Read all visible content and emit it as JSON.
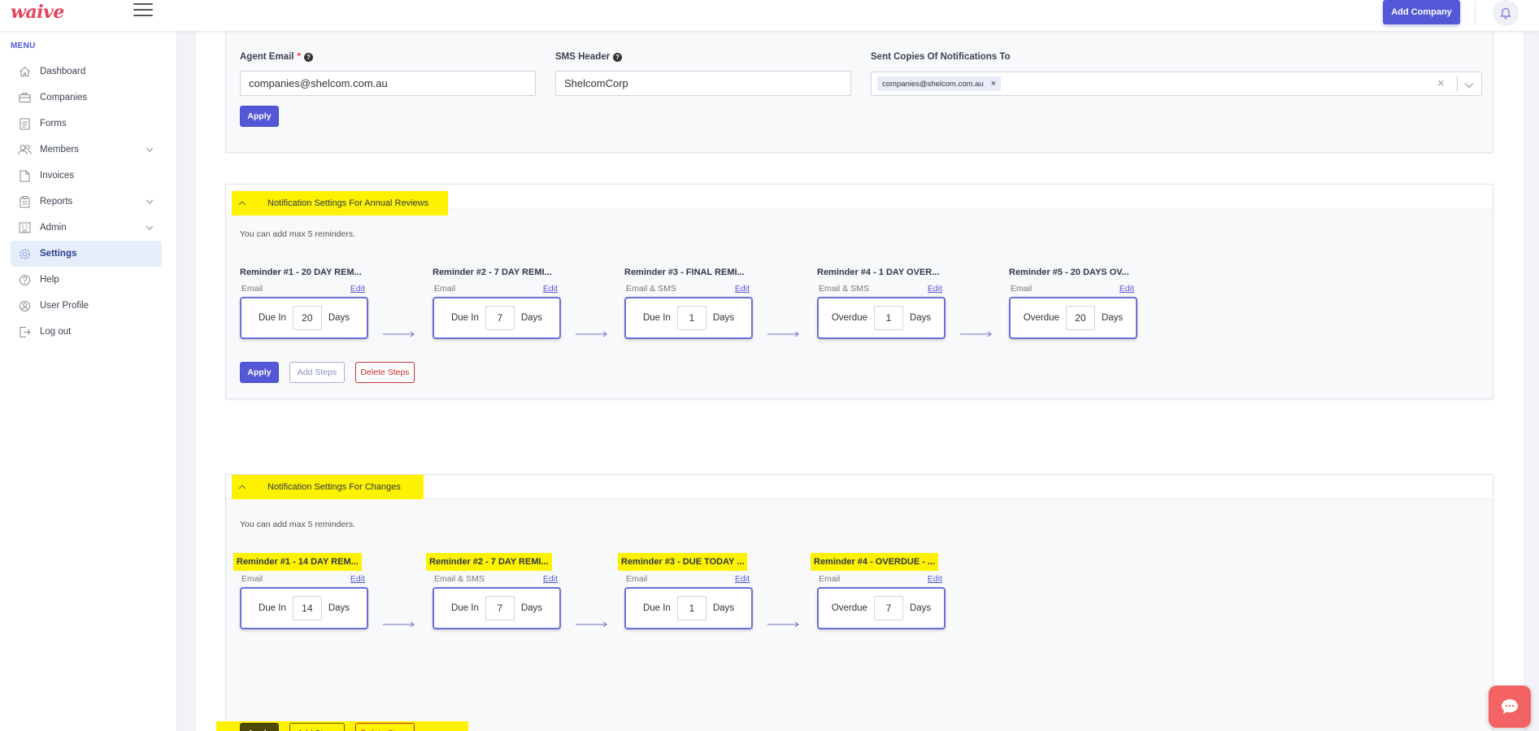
{
  "app": {
    "logo": "waive"
  },
  "topbar": {
    "add_company_label": "Add Company"
  },
  "sidebar": {
    "menu_label": "MENU",
    "items": [
      {
        "label": "Dashboard",
        "icon": "home-icon"
      },
      {
        "label": "Companies",
        "icon": "briefcase-icon"
      },
      {
        "label": "Forms",
        "icon": "document-icon"
      },
      {
        "label": "Members",
        "icon": "users-icon",
        "has_children": true
      },
      {
        "label": "Invoices",
        "icon": "file-icon"
      },
      {
        "label": "Reports",
        "icon": "clipboard-icon",
        "has_children": true
      },
      {
        "label": "Admin",
        "icon": "building-icon",
        "has_children": true
      },
      {
        "label": "Settings",
        "icon": "gear-icon",
        "active": true
      },
      {
        "label": "Help",
        "icon": "help-icon"
      },
      {
        "label": "User Profile",
        "icon": "user-icon"
      },
      {
        "label": "Log out",
        "icon": "logout-icon"
      }
    ]
  },
  "general": {
    "agent_email_label": "Agent Email",
    "agent_email_required": "*",
    "agent_email_value": "companies@shelcom.com.au",
    "sms_header_label": "SMS Header",
    "sms_header_value": "ShelcomCorp",
    "sent_copies_label": "Sent Copies Of Notifications To",
    "sent_copies_chip": "companies@shelcom.com.au",
    "chip_remove": "×",
    "clear_all": "×",
    "apply_label": "Apply"
  },
  "annual": {
    "title": "Notification Settings For Annual Reviews",
    "note": "You can add max 5 reminders.",
    "steps": [
      {
        "title": "Reminder #1 - 20 DAY REM...",
        "channel": "Email",
        "edit": "Edit",
        "mode": "Due In",
        "value": "20",
        "unit": "Days"
      },
      {
        "title": "Reminder #2 - 7 DAY REMI...",
        "channel": "Email",
        "edit": "Edit",
        "mode": "Due In",
        "value": "7",
        "unit": "Days"
      },
      {
        "title": "Reminder #3 - FINAL REMI...",
        "channel": "Email & SMS",
        "edit": "Edit",
        "mode": "Due In",
        "value": "1",
        "unit": "Days"
      },
      {
        "title": "Reminder #4 - 1 DAY OVER...",
        "channel": "Email & SMS",
        "edit": "Edit",
        "mode": "Overdue",
        "value": "1",
        "unit": "Days"
      },
      {
        "title": "Reminder #5 - 20 DAYS OV...",
        "channel": "Email",
        "edit": "Edit",
        "mode": "Overdue",
        "value": "20",
        "unit": "Days"
      }
    ],
    "apply_label": "Apply",
    "add_steps_label": "Add Steps",
    "delete_steps_label": "Delete Steps"
  },
  "changes": {
    "title": "Notification Settings For Changes",
    "note": "You can add max 5 reminders.",
    "steps": [
      {
        "title": "Reminder #1 - 14 DAY REM...",
        "channel": "Email",
        "edit": "Edit",
        "mode": "Due In",
        "value": "14",
        "unit": "Days"
      },
      {
        "title": "Reminder #2 - 7 DAY REMI...",
        "channel": "Email & SMS",
        "edit": "Edit",
        "mode": "Due In",
        "value": "7",
        "unit": "Days"
      },
      {
        "title": "Reminder #3 - DUE TODAY ...",
        "channel": "Email",
        "edit": "Edit",
        "mode": "Due In",
        "value": "1",
        "unit": "Days"
      },
      {
        "title": "Reminder #4 - OVERDUE - ...",
        "channel": "Email",
        "edit": "Edit",
        "mode": "Overdue",
        "value": "7",
        "unit": "Days"
      }
    ],
    "apply_label": "Apply",
    "add_steps_label": "Add Steps",
    "delete_steps_label": "Delete Steps"
  },
  "colors": {
    "accent": "#5457d6",
    "highlight": "#fff200",
    "danger": "#c53030",
    "brand": "#e8425b",
    "chat": "#f46363"
  }
}
